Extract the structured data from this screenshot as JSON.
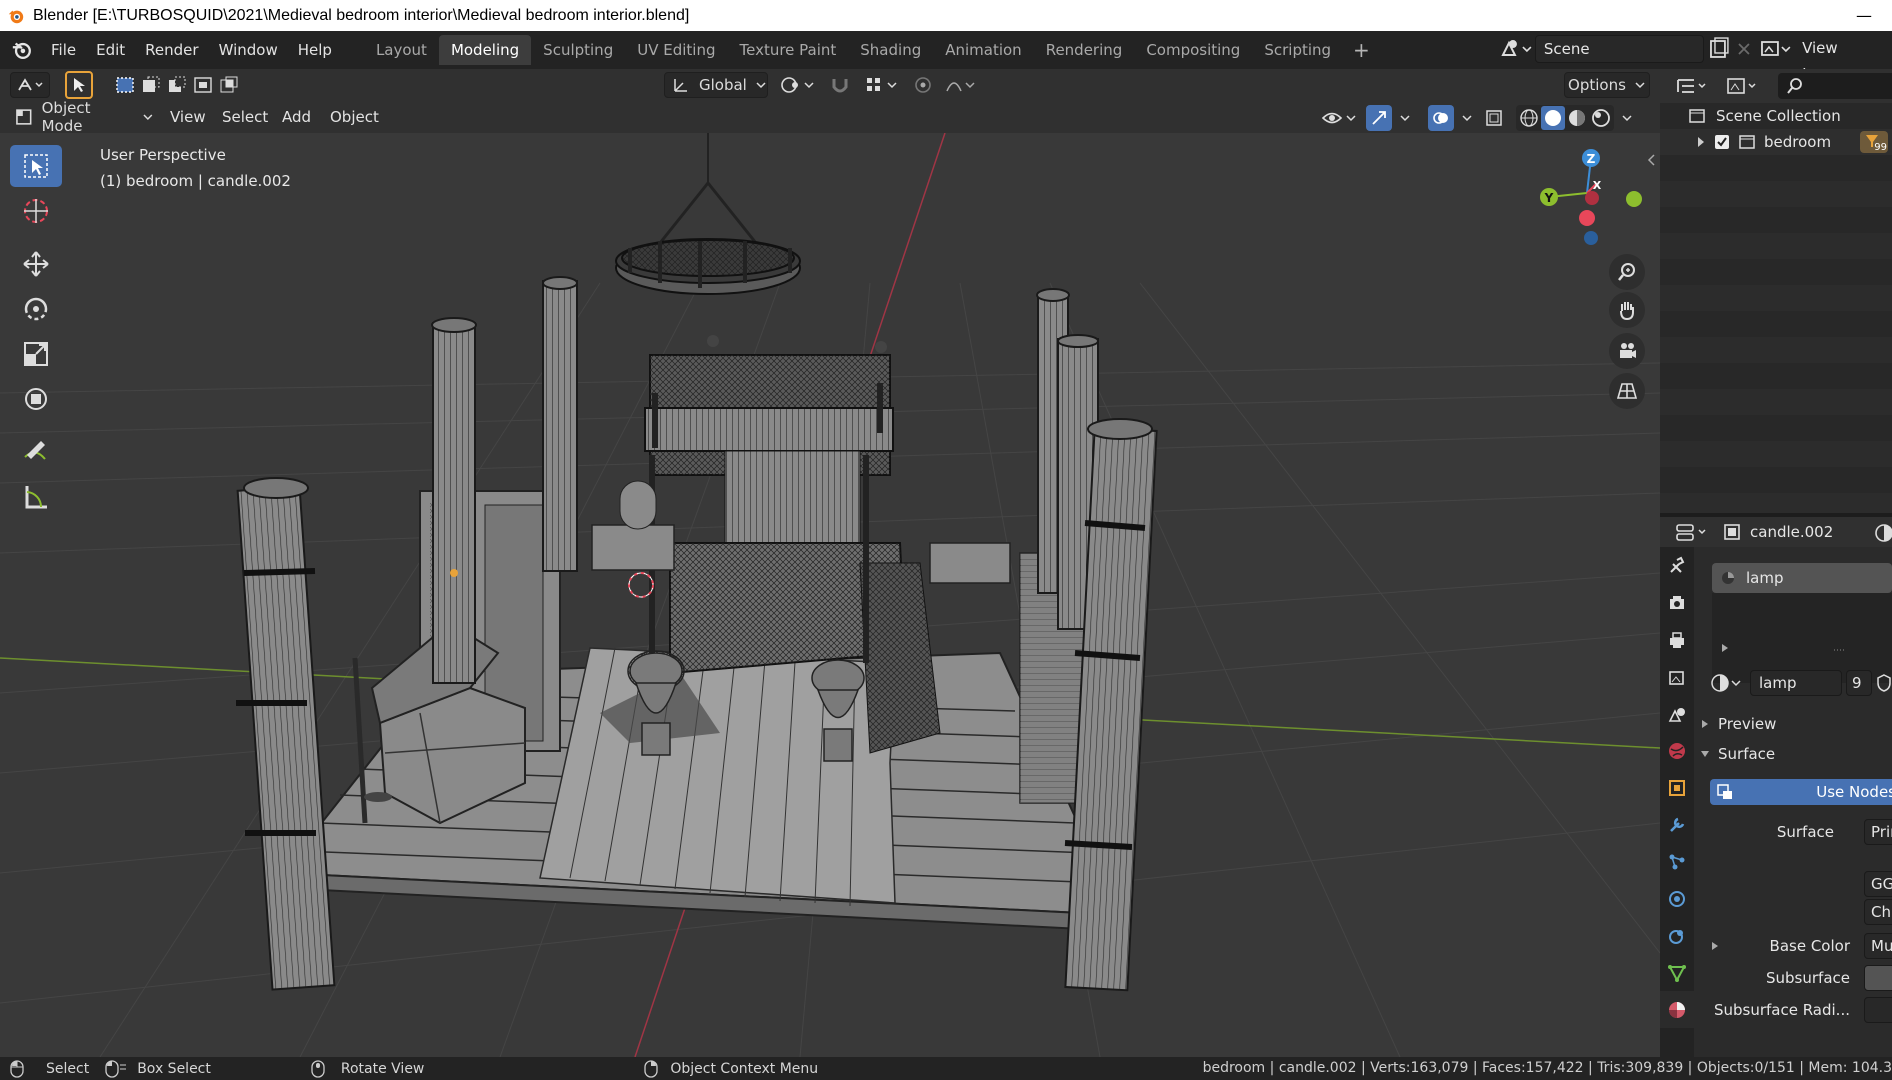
{
  "window": {
    "title": "Blender [E:\\TURBOSQUID\\2021\\Medieval bedroom interior\\Medieval bedroom interior.blend]",
    "minimize_glyph": "—"
  },
  "menu": {
    "items": [
      "File",
      "Edit",
      "Render",
      "Window",
      "Help"
    ]
  },
  "workspaces": {
    "tabs": [
      "Layout",
      "Modeling",
      "Sculpting",
      "UV Editing",
      "Texture Paint",
      "Shading",
      "Animation",
      "Rendering",
      "Compositing",
      "Scripting"
    ],
    "active": "Modeling",
    "add_glyph": "+"
  },
  "scene": {
    "name": "Scene",
    "view_layer": "View Layer"
  },
  "header": {
    "transform_orientation": "Global",
    "options_label": "Options",
    "mode_label": "Object Mode",
    "view_menu": [
      "View",
      "Select",
      "Add",
      "Object"
    ]
  },
  "viewport": {
    "perspective_label": "User Perspective",
    "object_info": "(1) bedroom | candle.002",
    "gizmo_axes": [
      "Z",
      "X",
      "Y"
    ]
  },
  "outliner": {
    "collection": "Scene Collection",
    "items": [
      {
        "label": "bedroom",
        "badge": "99"
      }
    ]
  },
  "properties": {
    "object_name": "candle.002",
    "material_slot": "lamp",
    "material_name": "lamp",
    "user_count": "9",
    "panels": {
      "preview": "Preview",
      "surface": "Surface"
    },
    "use_nodes_label": "Use Nodes",
    "fields": [
      {
        "label": "Surface",
        "value": "Prin"
      },
      {
        "label": "",
        "value": "GG"
      },
      {
        "label": "",
        "value": "Chr"
      },
      {
        "label": "Base Color",
        "value": "Mu"
      },
      {
        "label": "Subsurface",
        "value": ""
      },
      {
        "label": "Subsurface Radi...",
        "value": ""
      }
    ]
  },
  "status": {
    "select": "Select",
    "box_select": "Box Select",
    "rotate_view": "Rotate View",
    "context_menu": "Object Context Menu",
    "stats": "bedroom | candle.002 | Verts:163,079 | Faces:157,422 | Tris:309,839 | Objects:0/151 | Mem: 104.3"
  },
  "colors": {
    "accent_blue": "#4772b3",
    "viewport_bg": "#393939",
    "axis_x": "#e8475a",
    "axis_y": "#8dbe2e",
    "axis_z": "#3c8ed8"
  }
}
